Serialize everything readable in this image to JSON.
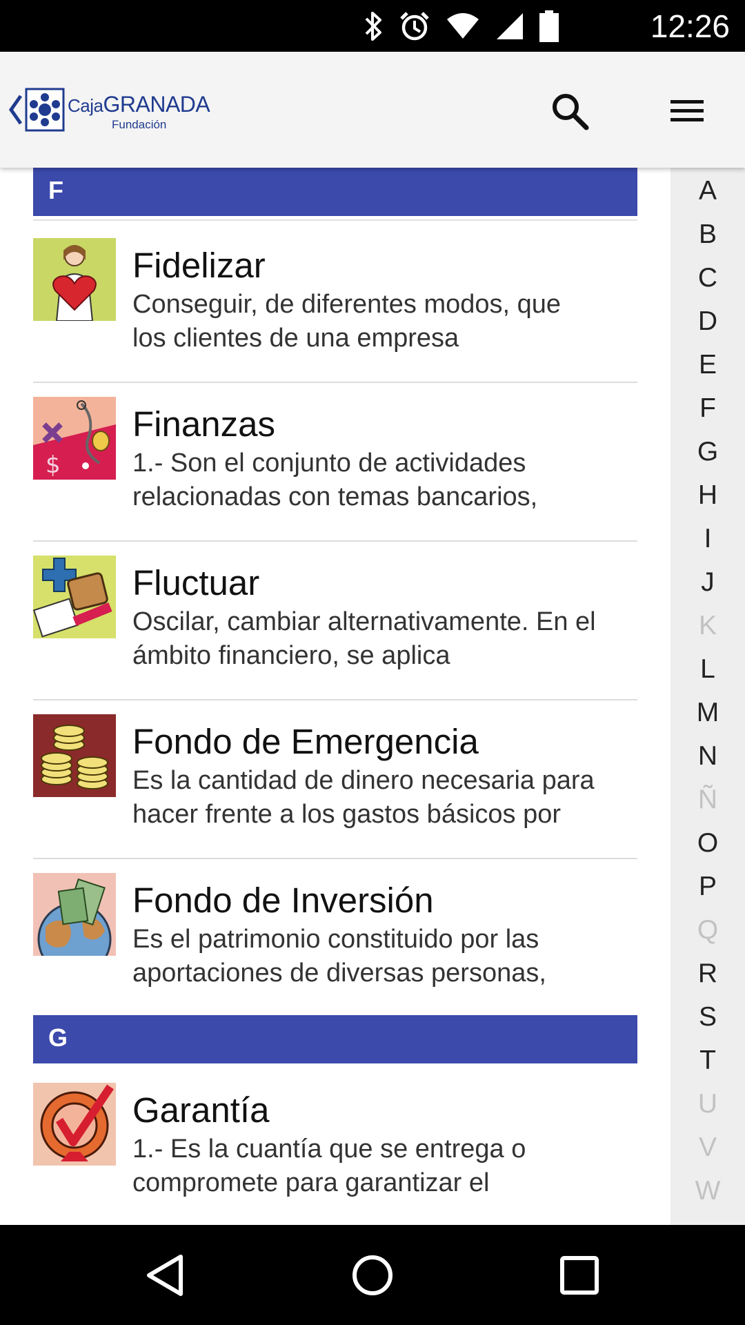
{
  "status_bar": {
    "time": "12:26",
    "icons": [
      "bluetooth-icon",
      "alarm-icon",
      "wifi-icon",
      "signal-icon",
      "battery-icon"
    ]
  },
  "header": {
    "logo_brand_part1": "Caja",
    "logo_brand_part2": "GRANADA",
    "logo_subtitle": "Fundación",
    "back_icon": "chevron-left-icon",
    "search_icon": "search-icon",
    "menu_icon": "hamburger-menu-icon"
  },
  "sections": [
    {
      "letter": "F",
      "items": [
        {
          "title": "Fidelizar",
          "desc1": "Conseguir, de diferentes modos, que",
          "desc2": "los clientes de una empresa",
          "icon": "heart-person-icon"
        },
        {
          "title": "Finanzas",
          "desc1": "1.- Son el conjunto de actividades",
          "desc2": "relacionadas con temas bancarios,",
          "icon": "finance-symbols-icon"
        },
        {
          "title": "Fluctuar",
          "desc1": "Oscilar, cambiar alternativamente. En el",
          "desc2": "ámbito financiero, se aplica",
          "icon": "fluctuation-icon"
        },
        {
          "title": "Fondo de Emergencia",
          "desc1": "Es la cantidad de dinero necesaria para",
          "desc2": "hacer frente a los gastos básicos por",
          "icon": "coin-stacks-icon"
        },
        {
          "title": "Fondo de Inversión",
          "desc1": "Es el patrimonio constituido por las",
          "desc2": "aportaciones de diversas personas,",
          "icon": "globe-money-icon"
        }
      ]
    },
    {
      "letter": "G",
      "items": [
        {
          "title": "Garantía",
          "desc1": "1.- Es la cuantía que se entrega o",
          "desc2": "compromete para garantizar el",
          "icon": "guarantee-seal-icon"
        }
      ]
    }
  ],
  "alphabet": [
    {
      "l": "A",
      "enabled": true
    },
    {
      "l": "B",
      "enabled": true
    },
    {
      "l": "C",
      "enabled": true
    },
    {
      "l": "D",
      "enabled": true
    },
    {
      "l": "E",
      "enabled": true
    },
    {
      "l": "F",
      "enabled": true
    },
    {
      "l": "G",
      "enabled": true
    },
    {
      "l": "H",
      "enabled": true
    },
    {
      "l": "I",
      "enabled": true
    },
    {
      "l": "J",
      "enabled": true
    },
    {
      "l": "K",
      "enabled": false
    },
    {
      "l": "L",
      "enabled": true
    },
    {
      "l": "M",
      "enabled": true
    },
    {
      "l": "N",
      "enabled": true
    },
    {
      "l": "Ñ",
      "enabled": false
    },
    {
      "l": "O",
      "enabled": true
    },
    {
      "l": "P",
      "enabled": true
    },
    {
      "l": "Q",
      "enabled": false
    },
    {
      "l": "R",
      "enabled": true
    },
    {
      "l": "S",
      "enabled": true
    },
    {
      "l": "T",
      "enabled": true
    },
    {
      "l": "U",
      "enabled": false
    },
    {
      "l": "V",
      "enabled": false
    },
    {
      "l": "W",
      "enabled": false
    }
  ],
  "colors": {
    "section_header": "#3b4aab",
    "brand": "#1f3b8f",
    "disabled_letter": "#c2c2c2"
  },
  "nav_bar": [
    "back-triangle-icon",
    "home-circle-icon",
    "recents-square-icon"
  ]
}
